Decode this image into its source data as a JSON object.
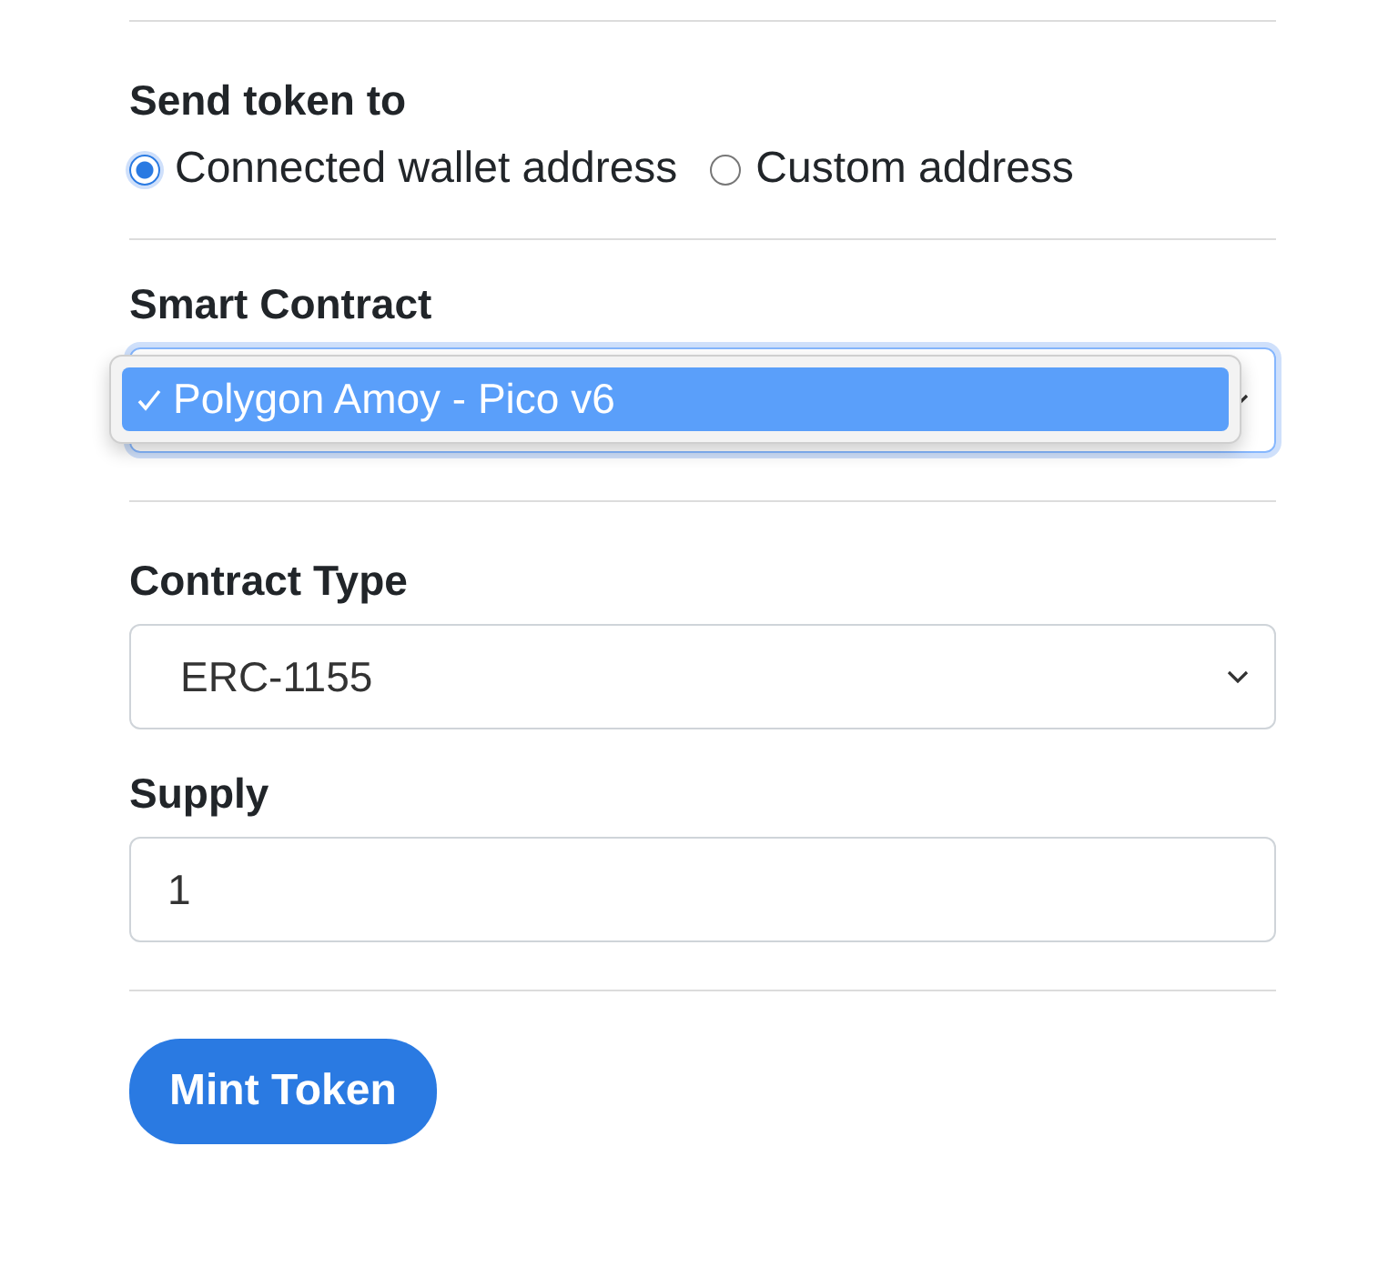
{
  "send_to": {
    "label": "Send token to",
    "options": [
      {
        "label": "Connected wallet address",
        "selected": true
      },
      {
        "label": "Custom address",
        "selected": false
      }
    ]
  },
  "smart_contract": {
    "label": "Smart Contract",
    "expanded": true,
    "options": [
      {
        "label": "Polygon Amoy - Pico v6",
        "selected": true
      }
    ]
  },
  "contract_type": {
    "label": "Contract Type",
    "value": "ERC-1155"
  },
  "supply": {
    "label": "Supply",
    "value": "1"
  },
  "submit": {
    "label": "Mint Token"
  }
}
